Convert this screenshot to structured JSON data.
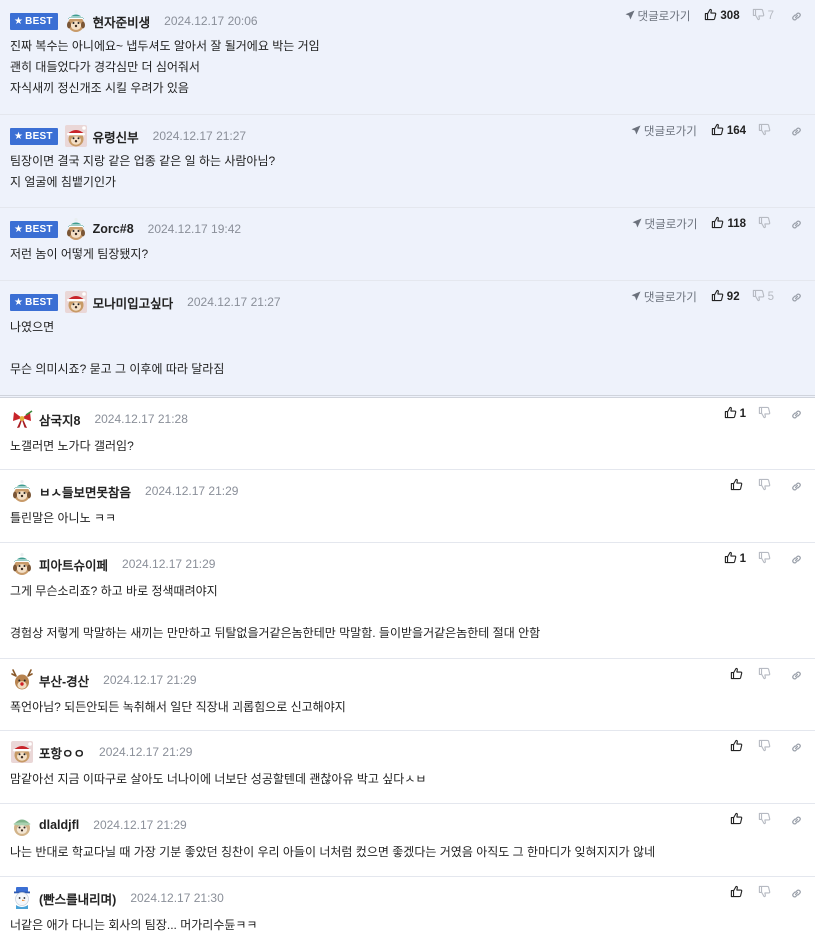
{
  "ui": {
    "best_label": "BEST",
    "reply_label": "댓글로가기"
  },
  "colors": {
    "best_bg": "#eef2fb",
    "badge": "#3b6fd4",
    "muted": "#8a8f99"
  },
  "icons": {
    "reply": "paper-plane-icon",
    "like": "thumbs-up-icon",
    "dislike": "thumbs-down-icon",
    "link": "link-icon"
  },
  "comments": [
    {
      "best": true,
      "avatar": "striped-hat-dog",
      "nick": "현자준비생",
      "time": "2024.12.17 20:06",
      "likes": "308",
      "dislikes": "7",
      "lines": [
        "진짜 복수는 아니에요~ 냅두셔도 알아서 잘 될거에요 박는 거임",
        "괜히 대들었다가 경각심만 더 심어줘서",
        "자식새끼 정신개조 시킬 우려가 있음"
      ]
    },
    {
      "best": true,
      "avatar": "santa-dog",
      "nick": "유령신부",
      "time": "2024.12.17 21:27",
      "likes": "164",
      "dislikes": "",
      "lines": [
        "팀장이면 결국 지랑 같은 업종 같은 일 하는 사람아님?",
        "지 얼굴에 침뱉기인가"
      ]
    },
    {
      "best": true,
      "avatar": "striped-hat-dog",
      "nick": "Zorc#8",
      "time": "2024.12.17 19:42",
      "likes": "118",
      "dislikes": "",
      "lines": [
        "저런 놈이 어떻게 팀장됐지?"
      ]
    },
    {
      "best": true,
      "avatar": "santa-dog",
      "nick": "모나미입고싶다",
      "time": "2024.12.17 21:27",
      "likes": "92",
      "dislikes": "5",
      "lines": [
        "나였으면",
        "",
        "무슨 의미시죠? 묻고 그 이후에 따라 달라짐"
      ]
    },
    {
      "best": false,
      "avatar": "ribbon",
      "nick": "삼국지8",
      "time": "2024.12.17 21:28",
      "likes": "1",
      "dislikes": "",
      "lines": [
        "노갤러면 노가다 갤러임?"
      ]
    },
    {
      "best": false,
      "avatar": "striped-hat-dog",
      "nick": "ㅂㅅ들보면못참음",
      "time": "2024.12.17 21:29",
      "likes": "",
      "dislikes": "",
      "lines": [
        "틀린말은 아니노 ㅋㅋ"
      ]
    },
    {
      "best": false,
      "avatar": "striped-hat-dog",
      "nick": "피아트슈이페",
      "time": "2024.12.17 21:29",
      "likes": "1",
      "dislikes": "",
      "lines": [
        "그게 무슨소리죠? 하고 바로 정색때려야지",
        "",
        "경험상 저렇게 막말하는 새끼는 만만하고 뒤탈없을거같은놈한테만 막말함. 들이받을거같은놈한테 절대 안함"
      ]
    },
    {
      "best": false,
      "avatar": "reindeer",
      "nick": "부산-경산",
      "time": "2024.12.17 21:29",
      "likes": "",
      "dislikes": "",
      "lines": [
        "폭언아님? 되든안되든 녹취해서 일단 직장내 괴롭힘으로 신고해야지"
      ]
    },
    {
      "best": false,
      "avatar": "santa-dog",
      "nick": "포항ㅇㅇ",
      "time": "2024.12.17 21:29",
      "likes": "",
      "dislikes": "",
      "lines": [
        "맘같아선 지금 이따구로 살아도 너나이에 너보단 성공할텐데 괜찮아유 박고 싶다ㅅㅂ"
      ]
    },
    {
      "best": false,
      "avatar": "green-hat-dog",
      "nick": "dlaldjfl",
      "time": "2024.12.17 21:29",
      "likes": "",
      "dislikes": "",
      "lines": [
        "나는 반대로 학교다닐 때 가장 기분 좋았던 칭찬이 우리 아들이 너처럼 컸으면 좋겠다는 거였음 아직도 그 한마디가 잊혀지지가 않네"
      ]
    },
    {
      "best": false,
      "avatar": "snowman",
      "nick": "(빤스를내리며)",
      "time": "2024.12.17 21:30",
      "likes": "",
      "dislikes": "",
      "lines": [
        "너같은 애가 다니는 회사의 팀장... 머가리수듄ㅋㅋ"
      ]
    }
  ]
}
